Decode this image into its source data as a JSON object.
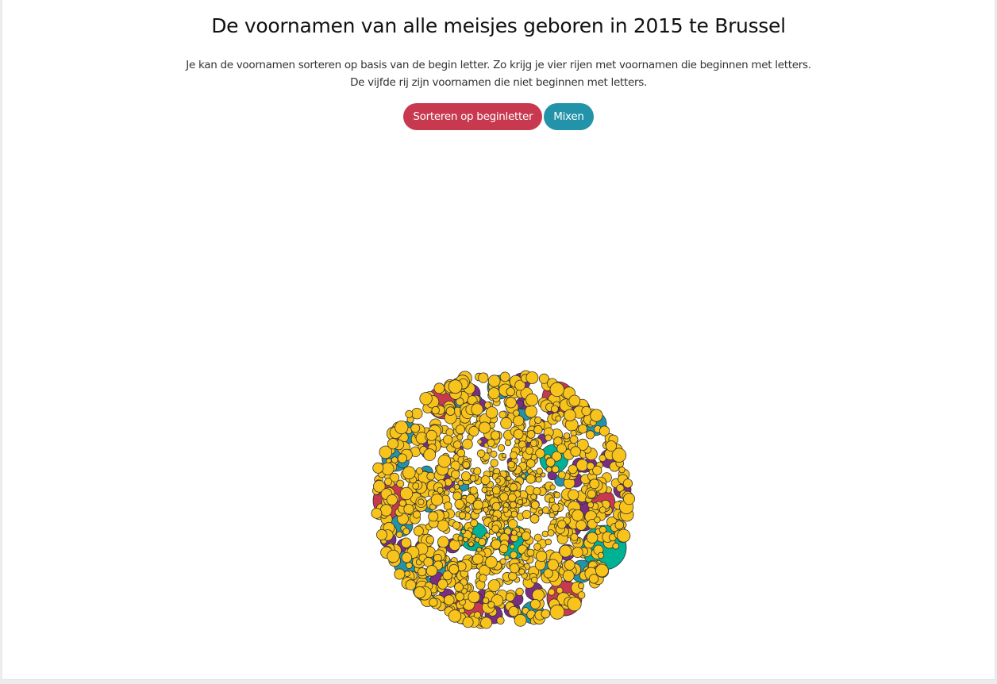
{
  "page": {
    "title": "De voornamen van alle meisjes geboren in 2015 te Brussel",
    "intro_line1": "Je kan de voornamen sorteren op basis van de begin letter. Zo krijg je vier rijen met voornamen die beginnen met letters.",
    "intro_line2": "De vijfde rij zijn voornamen die niet beginnen met letters."
  },
  "buttons": {
    "sort_label": "Sorteren op beginletter",
    "mix_label": "Mixen"
  },
  "chart_data": {
    "type": "bubble",
    "layout": "packed",
    "colors": {
      "red": "#c8394f",
      "blue": "#2293a8",
      "purple": "#7b2d84",
      "teal": "#00b295",
      "yellow": "#f8c31a"
    },
    "stroke_color": "#333333"
  }
}
